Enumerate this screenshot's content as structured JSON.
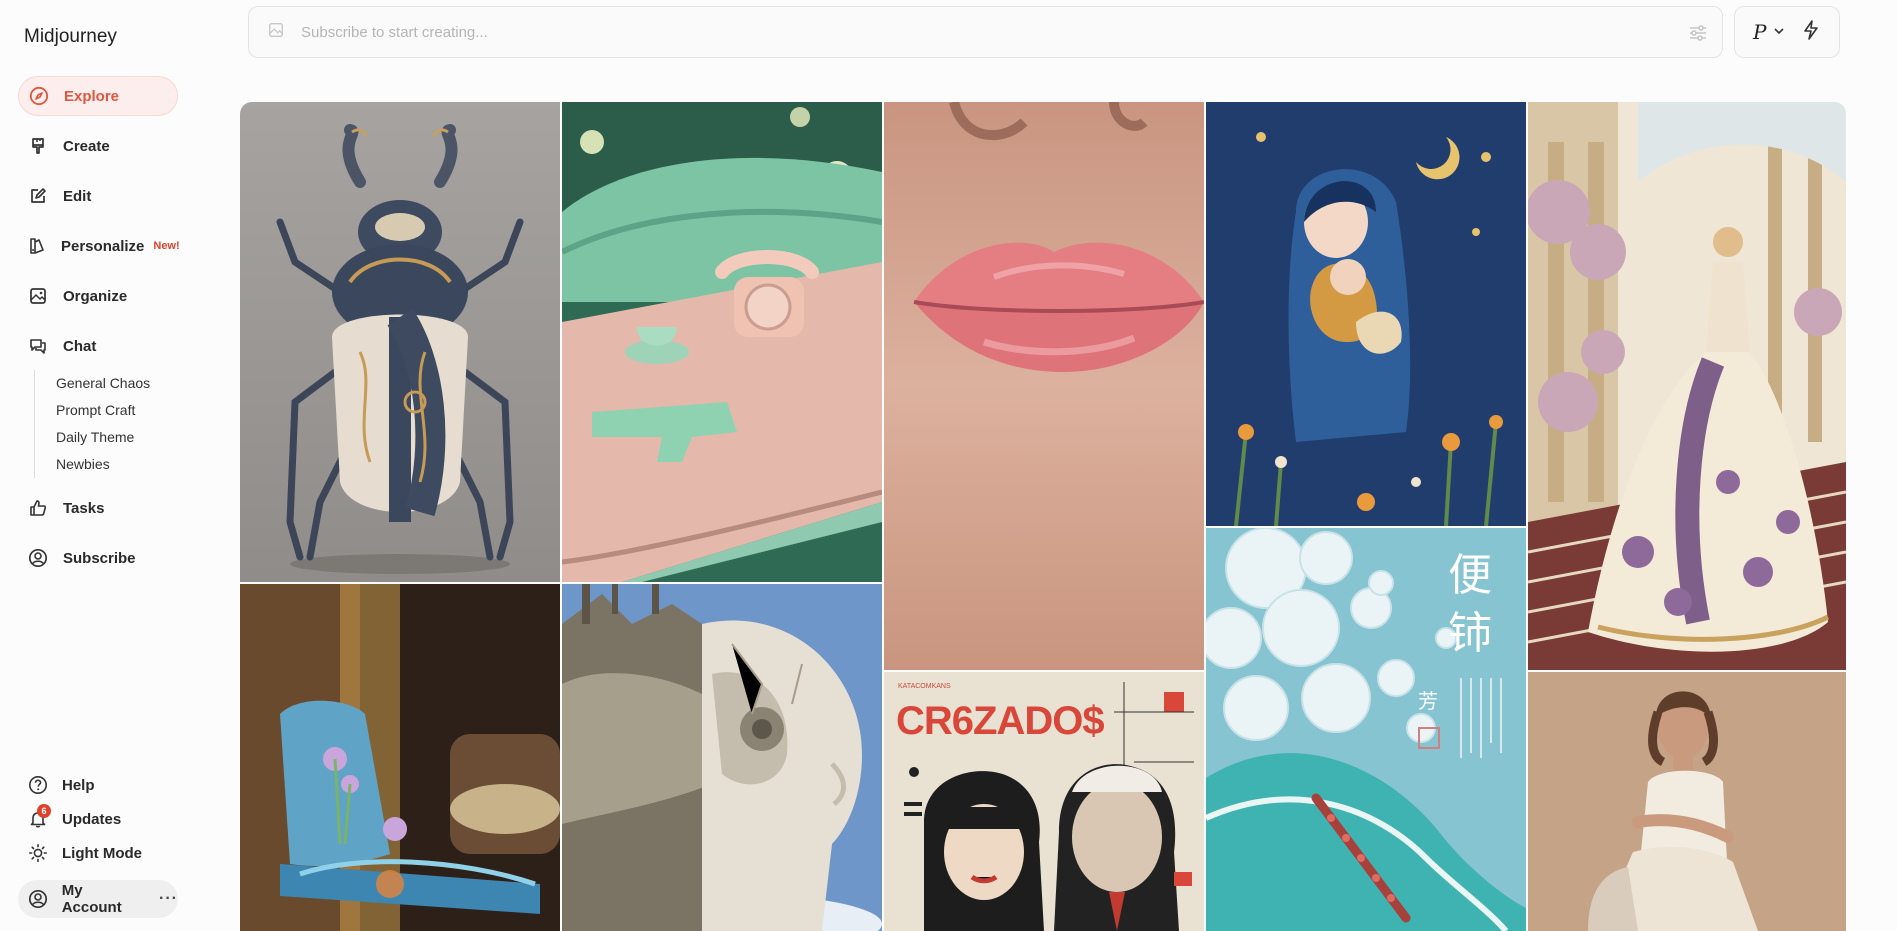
{
  "app": {
    "name": "Midjourney"
  },
  "nav": [
    {
      "label": "Explore",
      "icon": "compass-icon"
    },
    {
      "label": "Create",
      "icon": "brush-icon"
    },
    {
      "label": "Edit",
      "icon": "pencil-icon"
    },
    {
      "label": "Personalize",
      "icon": "palette-icon",
      "badge": "New!"
    },
    {
      "label": "Organize",
      "icon": "image-icon"
    },
    {
      "label": "Chat",
      "icon": "chat-icon"
    }
  ],
  "chat_channels": [
    "General Chaos",
    "Prompt Craft",
    "Daily Theme",
    "Newbies"
  ],
  "nav_after": [
    {
      "label": "Tasks",
      "icon": "thumbs-up-icon"
    },
    {
      "label": "Subscribe",
      "icon": "user-circle-icon"
    }
  ],
  "bottom": {
    "help": "Help",
    "updates": "Updates",
    "updates_count": "6",
    "light_mode": "Light Mode",
    "account": "My Account",
    "more": "···"
  },
  "search": {
    "placeholder": "Subscribe to start creating..."
  },
  "mode": {
    "label": "P"
  },
  "colors": {
    "accent": "#e0563e",
    "active_bg": "#fdeeee",
    "badge": "#e0412c"
  },
  "gallery": [
    {
      "name": "ornate-beetle-image",
      "desc": "ornate beetle"
    },
    {
      "name": "retro-diner-phone-image",
      "desc": "green telephone and toy gun"
    },
    {
      "name": "lips-closeup-image",
      "desc": "lips close-up"
    },
    {
      "name": "felt-mother-child-image",
      "desc": "felt mother and child"
    },
    {
      "name": "palace-gown-image",
      "desc": "woman in ornate gown"
    },
    {
      "name": "glass-chair-image",
      "desc": "resin flower chair"
    },
    {
      "name": "stone-head-city-image",
      "desc": "stone head with city"
    },
    {
      "name": "poster-faces-image",
      "desc": "retro poster faces"
    },
    {
      "name": "bubble-wave-image",
      "desc": "bubble wave poster"
    },
    {
      "name": "white-dress-portrait-image",
      "desc": "woman in white dress"
    }
  ],
  "poster": {
    "title": "CR6ZADO$",
    "kicker": "KATACOMKANS"
  },
  "wave_poster": {
    "chars": [
      "便",
      "铈"
    ],
    "small": "芳"
  }
}
